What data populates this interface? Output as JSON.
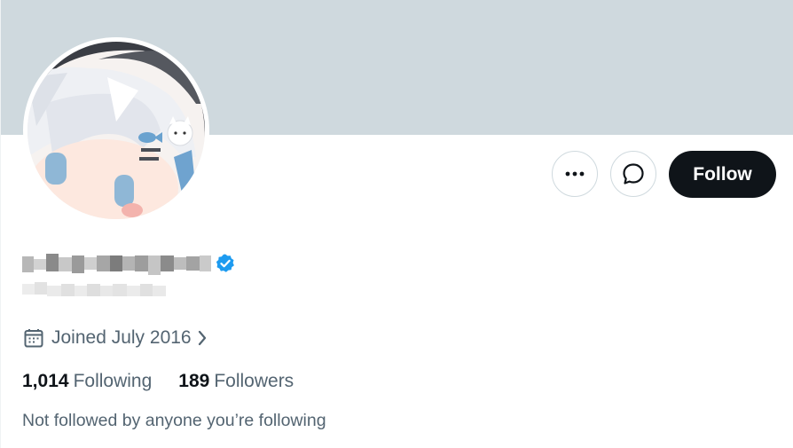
{
  "profile": {
    "display_name_label": "blurred display name",
    "joined": "Joined July 2016",
    "following": {
      "count": "1,014",
      "label": "Following"
    },
    "followers": {
      "count": "189",
      "label": "Followers"
    },
    "not_followed_text": "Not followed by anyone you’re following"
  },
  "actions": {
    "follow_label": "Follow"
  },
  "icons": {
    "more": "more-horizontal-icon",
    "message": "message-bubble-icon",
    "verified": "verified-badge-icon",
    "calendar": "calendar-icon",
    "chevron": "chevron-right-icon"
  },
  "colors": {
    "banner": "#cfd9de",
    "follow_bg": "#0f1419",
    "verified": "#1d9bf0",
    "secondary_text": "#536471"
  }
}
